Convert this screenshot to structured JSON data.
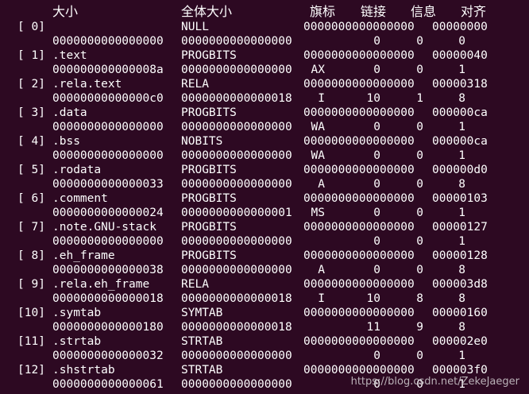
{
  "colors": {
    "background": "#2d0922",
    "text": "#ffffff"
  },
  "header": {
    "size": "大小",
    "entsize": "全体大小",
    "flags": "旗标",
    "link": "链接",
    "info": "信息",
    "align": "对齐"
  },
  "sections": [
    {
      "nr": "[ 0]",
      "name": "",
      "type": "NULL",
      "address": "0000000000000000",
      "offset": "00000000",
      "size": "0000000000000000",
      "entsize": "0000000000000000",
      "flags": "",
      "link": "0",
      "info": "0",
      "align": "0"
    },
    {
      "nr": "[ 1]",
      "name": ".text",
      "type": "PROGBITS",
      "address": "0000000000000000",
      "offset": "00000040",
      "size": "000000000000008a",
      "entsize": "0000000000000000",
      "flags": "AX",
      "link": "0",
      "info": "0",
      "align": "1"
    },
    {
      "nr": "[ 2]",
      "name": ".rela.text",
      "type": "RELA",
      "address": "0000000000000000",
      "offset": "00000318",
      "size": "00000000000000c0",
      "entsize": "0000000000000018",
      "flags": "I",
      "link": "10",
      "info": "1",
      "align": "8"
    },
    {
      "nr": "[ 3]",
      "name": ".data",
      "type": "PROGBITS",
      "address": "0000000000000000",
      "offset": "000000ca",
      "size": "0000000000000000",
      "entsize": "0000000000000000",
      "flags": "WA",
      "link": "0",
      "info": "0",
      "align": "1"
    },
    {
      "nr": "[ 4]",
      "name": ".bss",
      "type": "NOBITS",
      "address": "0000000000000000",
      "offset": "000000ca",
      "size": "0000000000000000",
      "entsize": "0000000000000000",
      "flags": "WA",
      "link": "0",
      "info": "0",
      "align": "1"
    },
    {
      "nr": "[ 5]",
      "name": ".rodata",
      "type": "PROGBITS",
      "address": "0000000000000000",
      "offset": "000000d0",
      "size": "0000000000000033",
      "entsize": "0000000000000000",
      "flags": "A",
      "link": "0",
      "info": "0",
      "align": "8"
    },
    {
      "nr": "[ 6]",
      "name": ".comment",
      "type": "PROGBITS",
      "address": "0000000000000000",
      "offset": "00000103",
      "size": "0000000000000024",
      "entsize": "0000000000000001",
      "flags": "MS",
      "link": "0",
      "info": "0",
      "align": "1"
    },
    {
      "nr": "[ 7]",
      "name": ".note.GNU-stack",
      "type": "PROGBITS",
      "address": "0000000000000000",
      "offset": "00000127",
      "size": "0000000000000000",
      "entsize": "0000000000000000",
      "flags": "",
      "link": "0",
      "info": "0",
      "align": "1"
    },
    {
      "nr": "[ 8]",
      "name": ".eh_frame",
      "type": "PROGBITS",
      "address": "0000000000000000",
      "offset": "00000128",
      "size": "0000000000000038",
      "entsize": "0000000000000000",
      "flags": "A",
      "link": "0",
      "info": "0",
      "align": "8"
    },
    {
      "nr": "[ 9]",
      "name": ".rela.eh_frame",
      "type": "RELA",
      "address": "0000000000000000",
      "offset": "000003d8",
      "size": "0000000000000018",
      "entsize": "0000000000000018",
      "flags": "I",
      "link": "10",
      "info": "8",
      "align": "8"
    },
    {
      "nr": "[10]",
      "name": ".symtab",
      "type": "SYMTAB",
      "address": "0000000000000000",
      "offset": "00000160",
      "size": "0000000000000180",
      "entsize": "0000000000000018",
      "flags": "",
      "link": "11",
      "info": "9",
      "align": "8"
    },
    {
      "nr": "[11]",
      "name": ".strtab",
      "type": "STRTAB",
      "address": "0000000000000000",
      "offset": "000002e0",
      "size": "0000000000000032",
      "entsize": "0000000000000000",
      "flags": "",
      "link": "0",
      "info": "0",
      "align": "1"
    },
    {
      "nr": "[12]",
      "name": ".shstrtab",
      "type": "STRTAB",
      "address": "0000000000000000",
      "offset": "000003f0",
      "size": "0000000000000061",
      "entsize": "0000000000000000",
      "flags": "",
      "link": "0",
      "info": "0",
      "align": "1"
    }
  ],
  "watermark": "https://blog.csdn.net/ZekeJaeger"
}
